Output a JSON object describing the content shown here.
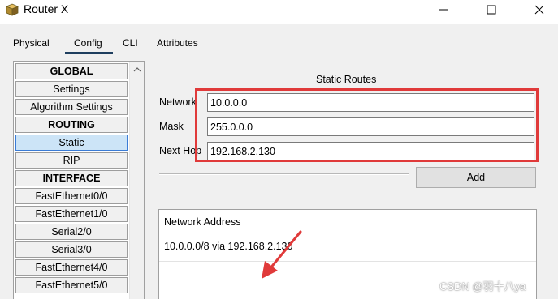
{
  "window": {
    "title": "Router X"
  },
  "tabs": [
    {
      "label": "Physical"
    },
    {
      "label": "Config"
    },
    {
      "label": "CLI"
    },
    {
      "label": "Attributes"
    }
  ],
  "sidebar": {
    "items": [
      {
        "label": "GLOBAL"
      },
      {
        "label": "Settings"
      },
      {
        "label": "Algorithm Settings"
      },
      {
        "label": "ROUTING"
      },
      {
        "label": "Static"
      },
      {
        "label": "RIP"
      },
      {
        "label": "INTERFACE"
      },
      {
        "label": "FastEthernet0/0"
      },
      {
        "label": "FastEthernet1/0"
      },
      {
        "label": "Serial2/0"
      },
      {
        "label": "Serial3/0"
      },
      {
        "label": "FastEthernet4/0"
      },
      {
        "label": "FastEthernet5/0"
      }
    ]
  },
  "static_routes": {
    "title": "Static Routes",
    "network_label": "Network",
    "network_value": "10.0.0.0",
    "mask_label": "Mask",
    "mask_value": "255.0.0.0",
    "next_hop_label": "Next Hop",
    "next_hop_value": "192.168.2.130",
    "add_label": "Add",
    "list_header": "Network Address",
    "routes": [
      {
        "text": "10.0.0.0/8 via 192.168.2.130"
      }
    ]
  },
  "annotation_color": "#e03a3a",
  "watermark": "CSDN @羽十八ya"
}
